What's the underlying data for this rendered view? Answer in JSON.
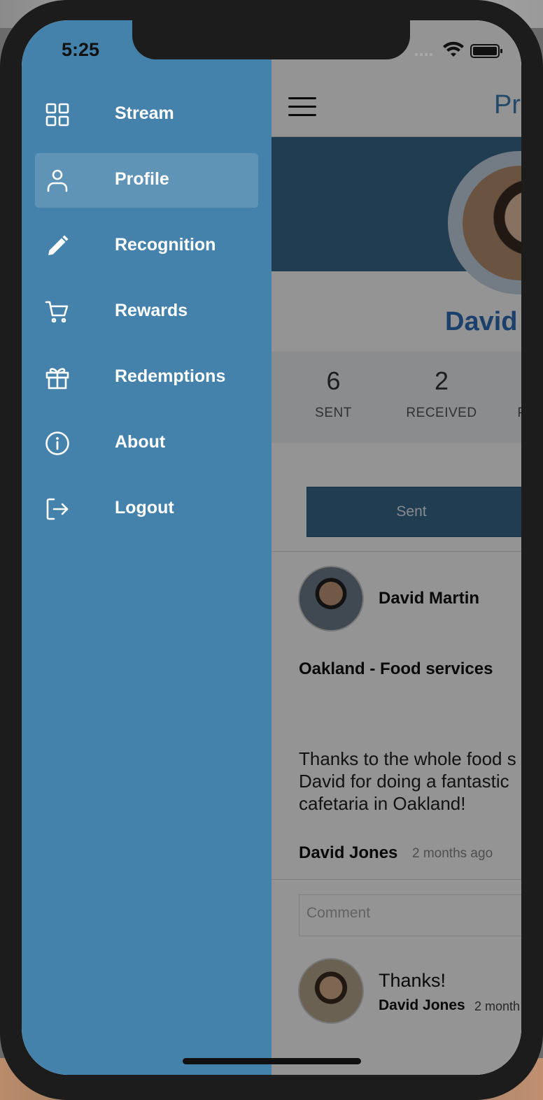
{
  "status_bar": {
    "time": "5:25"
  },
  "drawer": {
    "items": [
      {
        "label": "Stream",
        "icon": "grid-icon",
        "active": false
      },
      {
        "label": "Profile",
        "icon": "user-icon",
        "active": true
      },
      {
        "label": "Recognition",
        "icon": "pencil-icon",
        "active": false
      },
      {
        "label": "Rewards",
        "icon": "cart-icon",
        "active": false
      },
      {
        "label": "Redemptions",
        "icon": "gift-icon",
        "active": false
      },
      {
        "label": "About",
        "icon": "info-icon",
        "active": false
      },
      {
        "label": "Logout",
        "icon": "logout-icon",
        "active": false
      }
    ]
  },
  "profile_page": {
    "nav_title": "Pro",
    "name": "David",
    "stats": [
      {
        "value": "6",
        "label": "SENT"
      },
      {
        "value": "2",
        "label": "RECEIVED"
      },
      {
        "value": "",
        "label": "P"
      }
    ],
    "tab_sent": "Sent",
    "post": {
      "recipient": "David Martin",
      "location": "Oakland - Food services",
      "message_lines": [
        "Thanks to the whole food s",
        "David for doing a fantastic",
        "cafetaria in Oakland!"
      ],
      "author": "David Jones",
      "time": "2 months ago",
      "comment_placeholder": "Comment",
      "reply": {
        "text": "Thanks!",
        "author": "David Jones",
        "time": "2 month"
      }
    }
  },
  "colors": {
    "drawer_bg": "#4582ab",
    "cover_bg": "#3a6a8e",
    "accent": "#2f6fb8"
  }
}
